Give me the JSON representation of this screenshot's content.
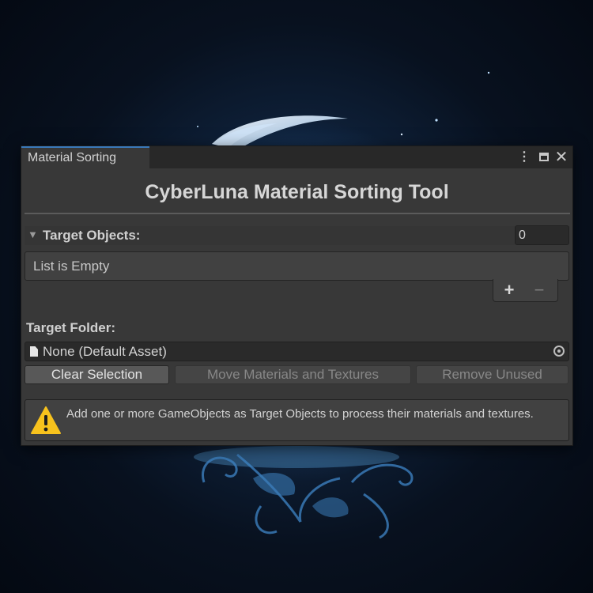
{
  "window": {
    "tab_label": "Material Sorting",
    "title": "CyberLuna Material Sorting Tool",
    "controls": {
      "more_icon": "kebab-menu-icon",
      "maximize_icon": "maximize-icon",
      "close_icon": "close-icon",
      "more_glyph": "⋮",
      "close_glyph": "✕"
    }
  },
  "target_objects": {
    "label": "Target Objects:",
    "count": "0",
    "empty_text": "List is Empty",
    "add_glyph": "+",
    "remove_glyph": "−"
  },
  "target_folder": {
    "label": "Target Folder:",
    "value": "None (Default Asset)",
    "icon": "file-icon"
  },
  "buttons": {
    "clear_label": "Clear Selection",
    "move_label": "Move Materials and Textures",
    "remove_label": "Remove Unused"
  },
  "help": {
    "icon": "warning-icon",
    "text": "Add one or more GameObjects as Target Objects to process their materials and textures."
  },
  "colors": {
    "accent": "#3a79bb",
    "panel": "#383838",
    "warning": "#f7c21d"
  }
}
